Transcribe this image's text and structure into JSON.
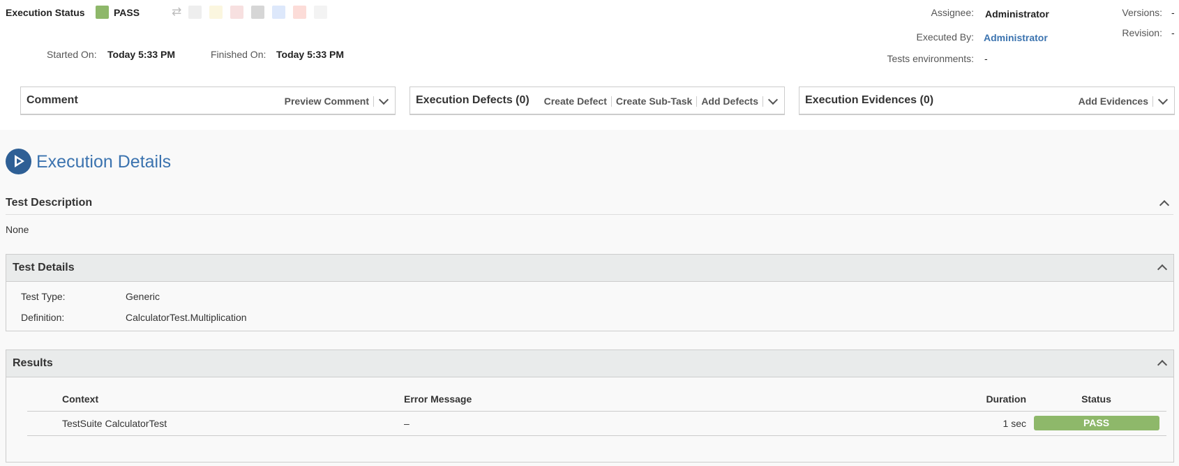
{
  "header": {
    "execution_status_label": "Execution Status",
    "status_value": "PASS",
    "status_color": "#8eb86a",
    "status_swatches": [
      "#eeeeee",
      "#fbf6df",
      "#f7e0e0",
      "#d6d6d6",
      "#dde8fb",
      "#fcdcd8",
      "#f3f3f3"
    ],
    "started_on_label": "Started On:",
    "started_on_value": "Today 5:33 PM",
    "finished_on_label": "Finished On:",
    "finished_on_value": "Today 5:33 PM",
    "assignee_label": "Assignee:",
    "assignee_value": "Administrator",
    "executed_by_label": "Executed By:",
    "executed_by_value": "Administrator",
    "tests_env_label": "Tests environments:",
    "tests_env_value": "-",
    "versions_label": "Versions:",
    "versions_value": "-",
    "revision_label": "Revision:",
    "revision_value": "-"
  },
  "panels": {
    "comment": {
      "title": "Comment",
      "preview": "Preview Comment"
    },
    "defects": {
      "title": "Execution Defects (0)",
      "create_defect": "Create Defect",
      "create_subtask": "Create Sub-Task",
      "add_defects": "Add Defects"
    },
    "evidences": {
      "title": "Execution Evidences (0)",
      "add_evidences": "Add Evidences"
    }
  },
  "details": {
    "title": "Execution Details",
    "test_description_heading": "Test Description",
    "test_description_value": "None",
    "test_details_heading": "Test Details",
    "test_type_label": "Test Type:",
    "test_type_value": "Generic",
    "definition_label": "Definition:",
    "definition_value": "CalculatorTest.Multiplication"
  },
  "results": {
    "heading": "Results",
    "columns": [
      "Context",
      "Error Message",
      "Duration",
      "Status"
    ],
    "rows": [
      {
        "context": "TestSuite CalculatorTest",
        "error": "–",
        "duration": "1 sec",
        "status": "PASS"
      }
    ]
  }
}
